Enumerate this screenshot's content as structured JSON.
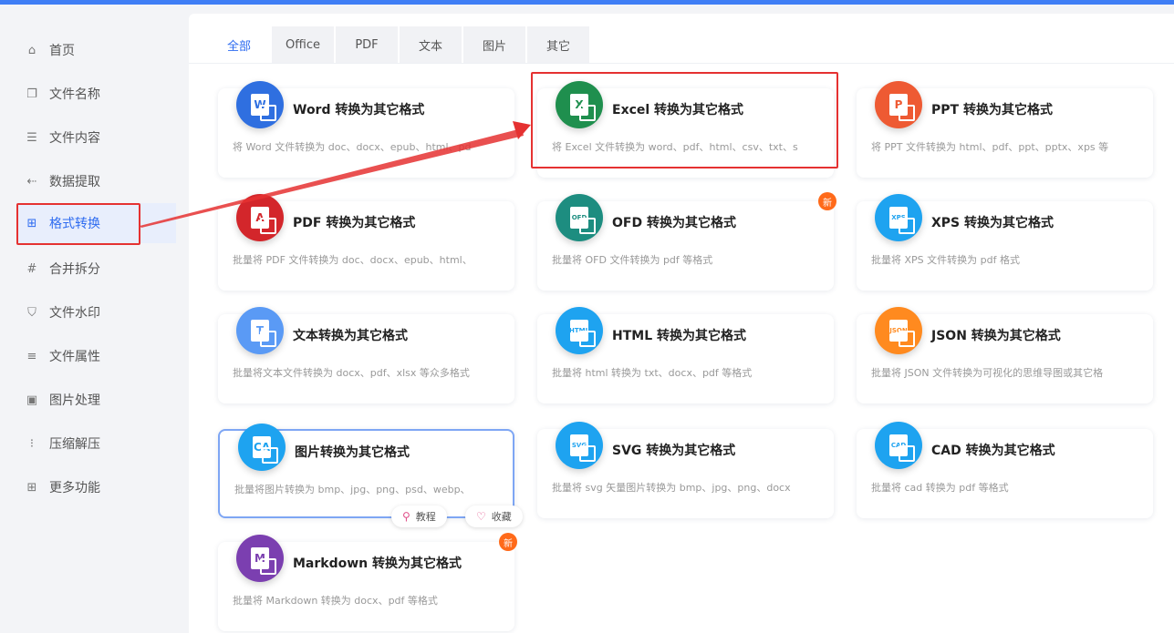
{
  "sidebar": {
    "items": [
      {
        "label": "首页",
        "icon": "⌂",
        "name": "home"
      },
      {
        "label": "文件名称",
        "icon": "❐",
        "name": "file-name"
      },
      {
        "label": "文件内容",
        "icon": "☰",
        "name": "file-content"
      },
      {
        "label": "数据提取",
        "icon": "⇠",
        "name": "data-extract"
      },
      {
        "label": "格式转换",
        "icon": "⊞",
        "name": "format-convert"
      },
      {
        "label": "合并拆分",
        "icon": "#",
        "name": "merge-split"
      },
      {
        "label": "文件水印",
        "icon": "⛉",
        "name": "watermark"
      },
      {
        "label": "文件属性",
        "icon": "≡",
        "name": "file-props"
      },
      {
        "label": "图片处理",
        "icon": "▣",
        "name": "image-process"
      },
      {
        "label": "压缩解压",
        "icon": "⁝",
        "name": "compress"
      },
      {
        "label": "更多功能",
        "icon": "⊞",
        "name": "more"
      }
    ],
    "active_index": 4
  },
  "tabs": [
    "全部",
    "Office",
    "PDF",
    "文本",
    "图片",
    "其它"
  ],
  "active_tab": 0,
  "cards": [
    {
      "title": "Word 转换为其它格式",
      "desc": "将 Word 文件转换为 doc、docx、epub、html、pd",
      "glyph": "W",
      "color": "#2f6fe0"
    },
    {
      "title": "Excel 转换为其它格式",
      "desc": "将 Excel 文件转换为 word、pdf、html、csv、txt、s",
      "glyph": "X",
      "color": "#1f8f4e"
    },
    {
      "title": "PPT 转换为其它格式",
      "desc": "将 PPT 文件转换为 html、pdf、ppt、pptx、xps 等",
      "glyph": "P",
      "color": "#ee5a33"
    },
    {
      "title": "PDF 转换为其它格式",
      "desc": "批量将 PDF 文件转换为 doc、docx、epub、html、",
      "glyph": "A",
      "color": "#d3262b"
    },
    {
      "title": "OFD 转换为其它格式",
      "desc": "批量将 OFD 文件转换为 pdf 等格式",
      "glyph": "OFD",
      "color": "#1d8d80",
      "badge": "新"
    },
    {
      "title": "XPS 转换为其它格式",
      "desc": "批量将 XPS 文件转换为 pdf 格式",
      "glyph": "XPS",
      "color": "#1ea3f0"
    },
    {
      "title": "文本转换为其它格式",
      "desc": "批量将文本文件转换为 docx、pdf、xlsx 等众多格式",
      "glyph": "T",
      "color": "#5a9af5"
    },
    {
      "title": "HTML 转换为其它格式",
      "desc": "批量将 html 转换为 txt、docx、pdf 等格式",
      "glyph": "HTML",
      "color": "#1ea3f0"
    },
    {
      "title": "JSON 转换为其它格式",
      "desc": "批量将 JSON 文件转换为可视化的思维导图或其它格",
      "glyph": "JSON",
      "color": "#ff8a1f"
    },
    {
      "title": "图片转换为其它格式",
      "desc": "批量将图片转换为 bmp、jpg、png、psd、webp、",
      "glyph": "CA",
      "color": "#1ea3f0",
      "selected": true
    },
    {
      "title": "SVG 转换为其它格式",
      "desc": "批量将 svg 矢量图片转换为 bmp、jpg、png、docx",
      "glyph": "SVG",
      "color": "#1ea3f0"
    },
    {
      "title": "CAD 转换为其它格式",
      "desc": "批量将 cad 转换为 pdf 等格式",
      "glyph": "CAD",
      "color": "#1ea3f0"
    },
    {
      "title": "Markdown 转换为其它格式",
      "desc": "批量将 Markdown 转换为 docx、pdf 等格式",
      "glyph": "M",
      "color": "#7b3fb0",
      "badge": "新"
    }
  ],
  "card_actions": {
    "tutorial": "教程",
    "favorite": "收藏"
  },
  "colors": {
    "accent": "#2d6bf0",
    "highlight": "#e53131",
    "badge": "#ff6a1a"
  }
}
